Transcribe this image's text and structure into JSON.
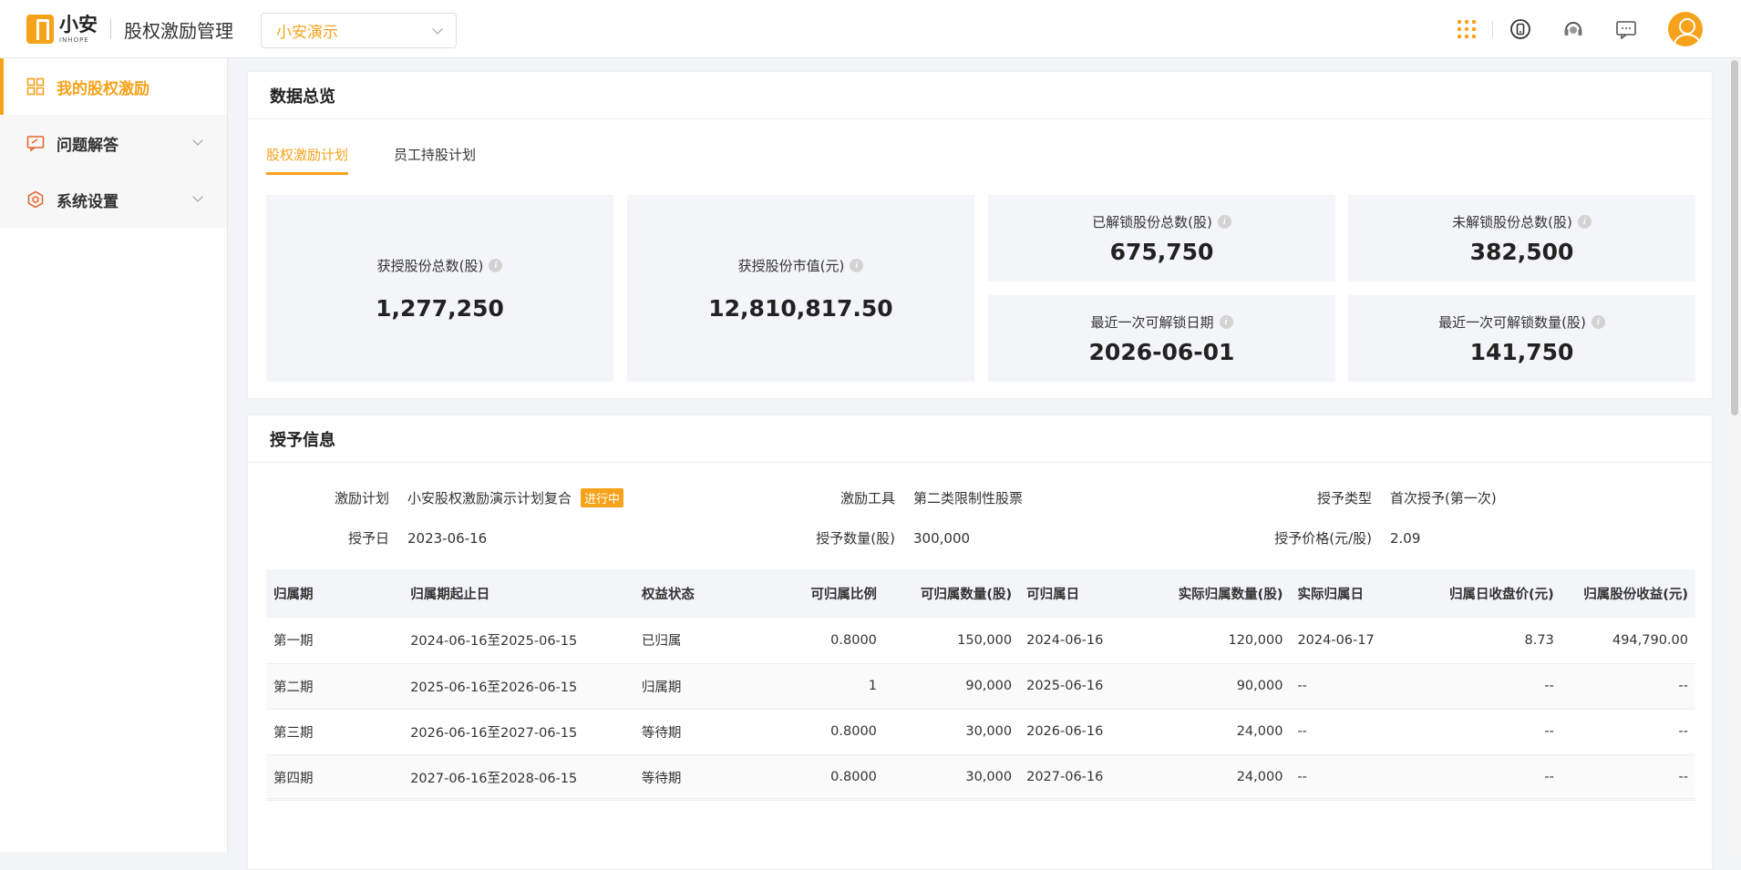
{
  "app": {
    "logo_cn": "小安",
    "logo_en": "INHOPE",
    "title": "股权激励管理",
    "selector_value": "小安演示"
  },
  "sidebar": {
    "items": [
      {
        "label": "我的股权激励",
        "icon": "grid-apps-icon",
        "active": true
      },
      {
        "label": "问题解答",
        "icon": "chat-edit-icon"
      },
      {
        "label": "系统设置",
        "icon": "settings-hex-icon"
      }
    ]
  },
  "overview": {
    "title": "数据总览",
    "tabs": [
      "股权激励计划",
      "员工持股计划"
    ],
    "cards": [
      {
        "label": "获授股份总数(股)",
        "value": "1,277,250"
      },
      {
        "label": "获授股份市值(元)",
        "value": "12,810,817.50"
      },
      {
        "label": "已解锁股份总数(股)",
        "value": "675,750"
      },
      {
        "label": "未解锁股份总数(股)",
        "value": "382,500"
      },
      {
        "label": "最近一次可解锁日期",
        "value": "2026-06-01"
      },
      {
        "label": "最近一次可解锁数量(股)",
        "value": "141,750"
      }
    ]
  },
  "grant": {
    "title": "授予信息",
    "fields": {
      "plan_k": "激励计划",
      "plan_v": "小安股权激励演示计划复合",
      "status": "进行中",
      "tool_k": "激励工具",
      "tool_v": "第二类限制性股票",
      "type_k": "授予类型",
      "type_v": "首次授予(第一次)",
      "date_k": "授予日",
      "date_v": "2023-06-16",
      "qty_k": "授予数量(股)",
      "qty_v": "300,000",
      "price_k": "授予价格(元/股)",
      "price_v": "2.09"
    },
    "table": {
      "headers": [
        "归属期",
        "归属期起止日",
        "权益状态",
        "可归属比例",
        "可归属数量(股)",
        "可归属日",
        "实际归属数量(股)",
        "实际归属日",
        "归属日收盘价(元)",
        "归属股份收益(元)"
      ],
      "rows": [
        [
          "第一期",
          "2024-06-16至2025-06-15",
          "已归属",
          "0.8000",
          "150,000",
          "2024-06-16",
          "120,000",
          "2024-06-17",
          "8.73",
          "494,790.00"
        ],
        [
          "第二期",
          "2025-06-16至2026-06-15",
          "归属期",
          "1",
          "90,000",
          "2025-06-16",
          "90,000",
          "--",
          "--",
          "--"
        ],
        [
          "第三期",
          "2026-06-16至2027-06-15",
          "等待期",
          "0.8000",
          "30,000",
          "2026-06-16",
          "24,000",
          "--",
          "--",
          "--"
        ],
        [
          "第四期",
          "2027-06-16至2028-06-15",
          "等待期",
          "0.8000",
          "30,000",
          "2027-06-16",
          "24,000",
          "--",
          "--",
          "--"
        ]
      ]
    }
  },
  "colors": {
    "accent": "#f7a21b",
    "card_bg": "#f4f5f8"
  }
}
